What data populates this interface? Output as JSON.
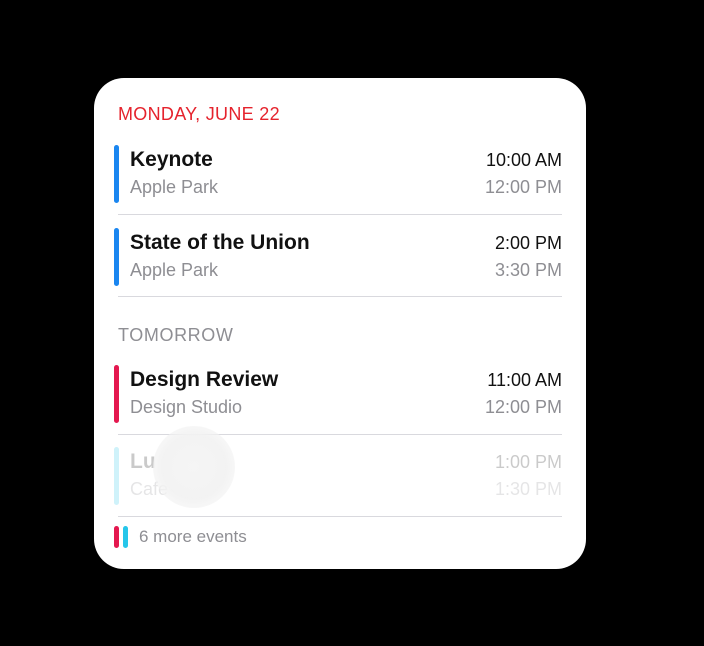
{
  "widget": {
    "date_header": "MONDAY, JUNE 22",
    "tomorrow_header": "TOMORROW",
    "more_events": "6 more events"
  },
  "colors": {
    "date_header": "#e5232d",
    "calendar_blue": "#1a86f0",
    "calendar_red": "#e4184f",
    "calendar_cyan": "#26c6ea"
  },
  "events_today": [
    {
      "title": "Keynote",
      "location": "Apple Park",
      "start": "10:00 AM",
      "end": "12:00 PM",
      "color": "#1a86f0"
    },
    {
      "title": "State of the Union",
      "location": "Apple Park",
      "start": "2:00 PM",
      "end": "3:30 PM",
      "color": "#1a86f0"
    }
  ],
  "events_tomorrow": [
    {
      "title": "Design Review",
      "location": "Design Studio",
      "start": "11:00 AM",
      "end": "12:00 PM",
      "color": "#e4184f"
    },
    {
      "title": "Lu",
      "location": "Cafe",
      "start": "1:00 PM",
      "end": "1:30 PM",
      "color": "#26c6ea"
    }
  ]
}
